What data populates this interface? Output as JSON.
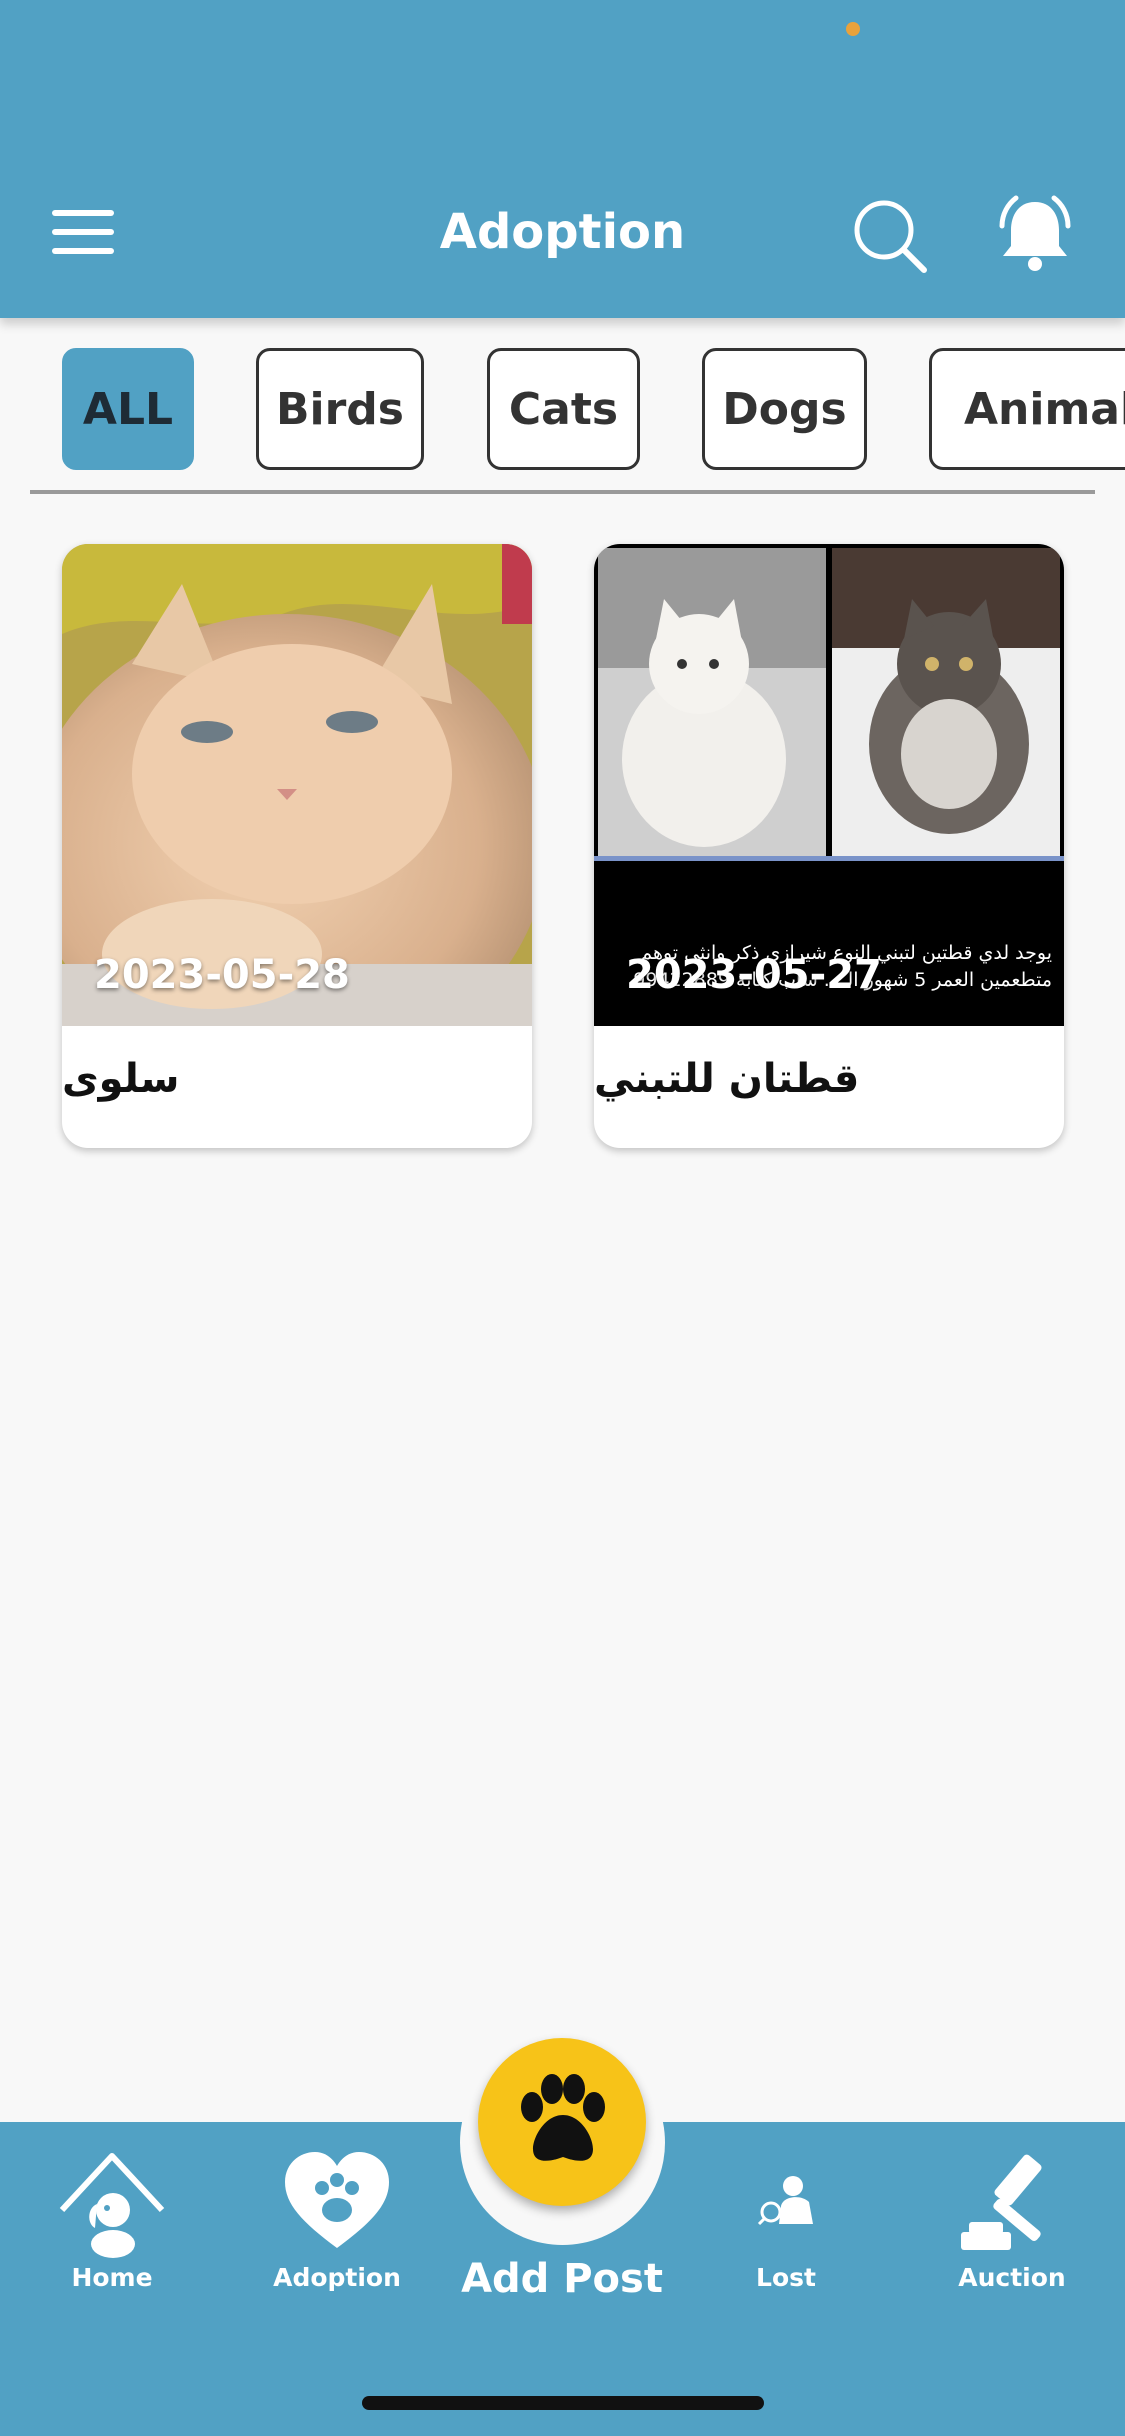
{
  "header": {
    "title": "Adoption",
    "menu_icon": "menu-icon",
    "search_icon": "search-icon",
    "bell_icon": "bell-icon",
    "status_indicator_color": "#e9a23b"
  },
  "filters": {
    "chips": [
      {
        "label": "ALL",
        "active": true
      },
      {
        "label": "Birds",
        "active": false
      },
      {
        "label": "Cats",
        "active": false
      },
      {
        "label": "Dogs",
        "active": false
      },
      {
        "label": "Animal",
        "active": false
      }
    ]
  },
  "posts": [
    {
      "title": "سلوى",
      "date": "2023-05-28",
      "image": "cream-cat-photo"
    },
    {
      "title": "قطتان للتبني",
      "date": "2023-05-27",
      "image": "two-persian-cats-photo",
      "overlay_text": "يوجد لدي قطتين لتبني النوع شيرازي ذكر وانثى توهم متطعمين العمر 5 شهور الـ... ساب كتابة 99422889"
    }
  ],
  "bottom_nav": {
    "items": [
      {
        "label": "Home",
        "icon": "home-dog-icon"
      },
      {
        "label": "Adoption",
        "icon": "heart-paw-icon"
      },
      {
        "label": "Lost",
        "icon": "lost-pet-icon"
      },
      {
        "label": "Auction",
        "icon": "gavel-icon"
      }
    ],
    "add_post": {
      "label": "Add Post",
      "icon": "paw-icon"
    }
  },
  "colors": {
    "primary": "#51a1c4",
    "accent": "#f7c318",
    "background": "#f8f8f8"
  }
}
